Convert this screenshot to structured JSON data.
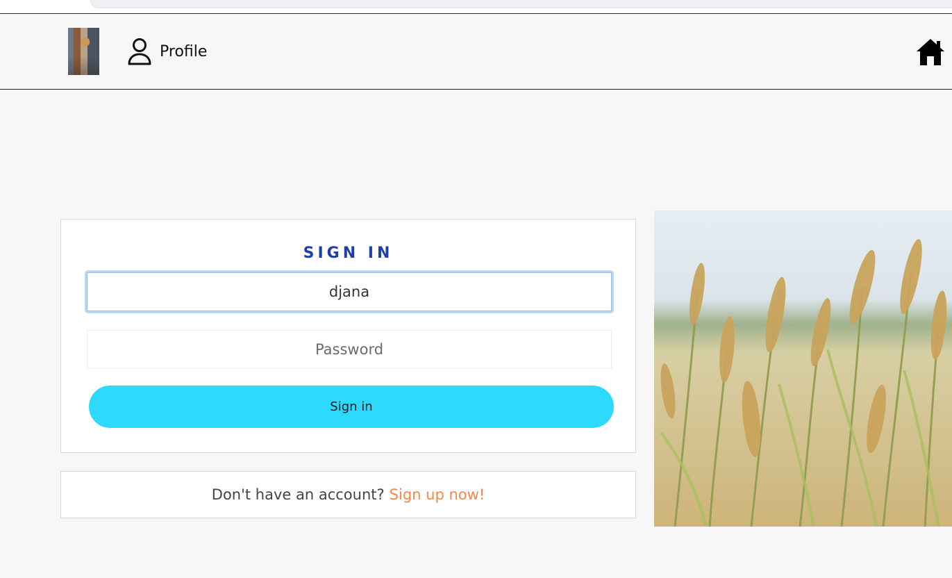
{
  "navbar": {
    "profile_label": "Profile",
    "profile_icon": "user-icon",
    "home_icon": "home-icon"
  },
  "signin": {
    "title": "SIGN IN",
    "username_value": "djana",
    "password_placeholder": "Password",
    "button_label": "Sign in"
  },
  "signup": {
    "prompt": "Don't have an account?",
    "link_label": "Sign up now!"
  },
  "colors": {
    "title": "#1f3fa6",
    "button": "#2dd9fc",
    "link": "#f5894b",
    "background": "#f7f7f7"
  }
}
